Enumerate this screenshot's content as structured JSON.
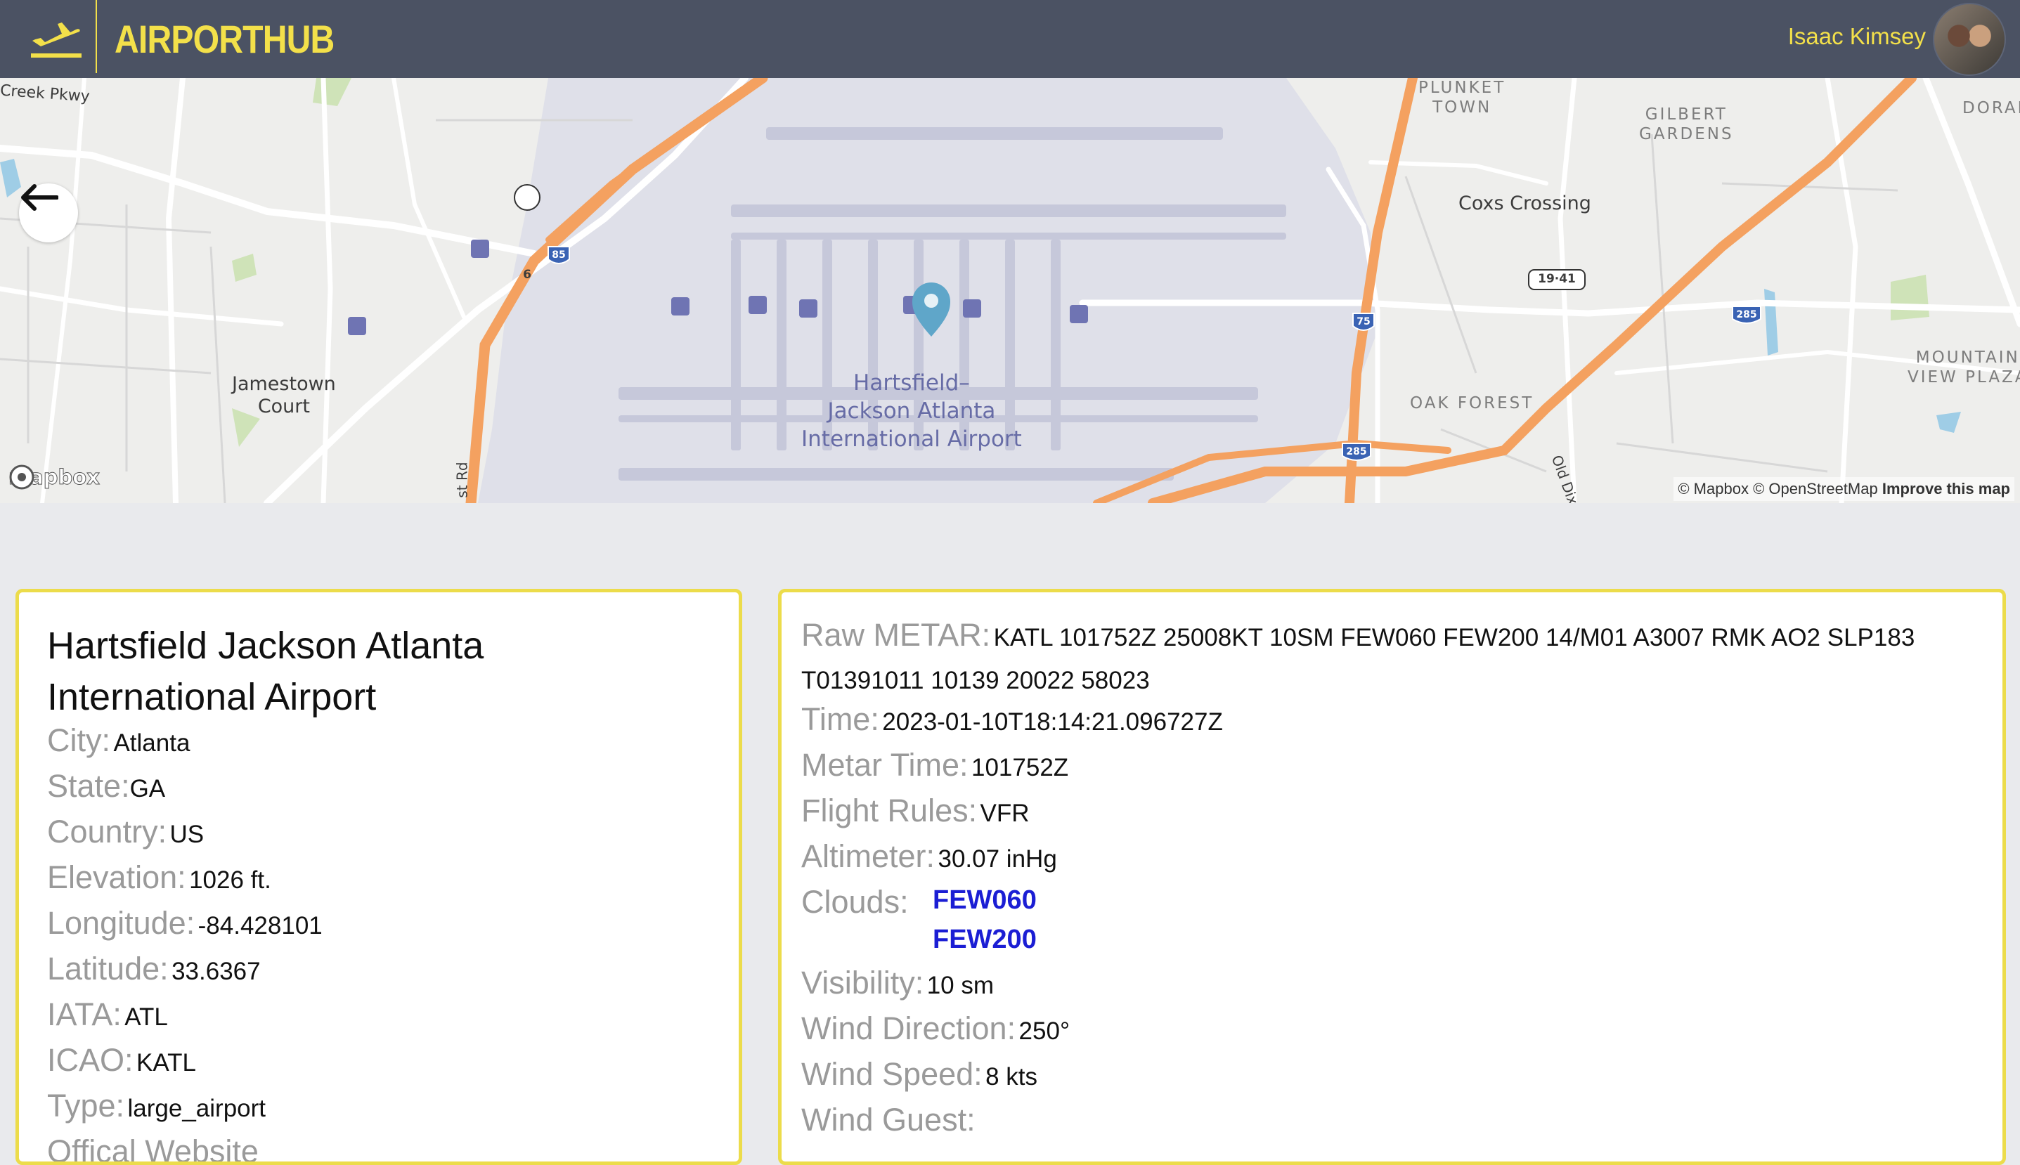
{
  "header": {
    "app_name": "AIRPORTHUB",
    "user_name": "Isaac Kimsey",
    "brand_color": "#f3e04a",
    "header_bg": "#4b5263"
  },
  "map": {
    "labels": {
      "road_creek": "Creek Pkwy",
      "jamestown": "Jamestown Court",
      "jamestown_line1": "Jamestown",
      "jamestown_line2": "Court",
      "airport_line1": "Hartsfield–",
      "airport_line2": "Jackson Atlanta",
      "airport_line3": "International Airport",
      "coxs": "Coxs Crossing",
      "plunket_line1": "PLUNKET",
      "plunket_line2": "TOWN",
      "gilbert_line1": "GILBERT",
      "gilbert_line2": "GARDENS",
      "doral": "DORAL",
      "oak_forest": "OAK FOREST",
      "mountain_line1": "MOUNTAIN",
      "mountain_line2": "VIEW PLAZA",
      "st_rd": "st Rd",
      "old_dix": "Old Dix",
      "shield_85": "85",
      "shield_75": "75",
      "shield_285a": "285",
      "shield_285b": "285",
      "shield_1941": "19·41",
      "shield_6": "6"
    },
    "mapbox_logo": "mapbox",
    "attribution": {
      "mapbox": "© Mapbox",
      "osm": "© OpenStreetMap",
      "improve": "Improve this map"
    }
  },
  "airport": {
    "name": "Hartsfield Jackson Atlanta International Airport",
    "city_label": "City:",
    "city": "Atlanta",
    "state_label": "State:",
    "state": "GA",
    "country_label": "Country:",
    "country": "US",
    "elevation_label": "Elevation:",
    "elevation": "1026 ft.",
    "longitude_label": "Longitude:",
    "longitude": "-84.428101",
    "latitude_label": "Latitude:",
    "latitude": "33.6367",
    "iata_label": "IATA:",
    "iata": "ATL",
    "icao_label": "ICAO:",
    "icao": "KATL",
    "type_label": "Type:",
    "type": "large_airport",
    "website_label": "Offical Website"
  },
  "metar": {
    "raw_label": "Raw METAR:",
    "raw_line1": "KATL 101752Z 25008KT 10SM FEW060 FEW200 14/M01 A3007 RMK AO2 SLP183",
    "raw_line2": "T01391011 10139 20022 58023",
    "time_label": "Time:",
    "time": "2023-01-10T18:14:21.096727Z",
    "metar_time_label": "Metar Time:",
    "metar_time": "101752Z",
    "flight_rules_label": "Flight Rules:",
    "flight_rules": "VFR",
    "altimeter_label": "Altimeter:",
    "altimeter": "30.07 inHg",
    "clouds_label": "Clouds:",
    "clouds": [
      "FEW060",
      "FEW200"
    ],
    "visibility_label": "Visibility:",
    "visibility": "10 sm",
    "wind_direction_label": "Wind Direction:",
    "wind_direction": "250°",
    "wind_speed_label": "Wind Speed:",
    "wind_speed": "8 kts",
    "wind_gust_label": "Wind Guest:"
  }
}
